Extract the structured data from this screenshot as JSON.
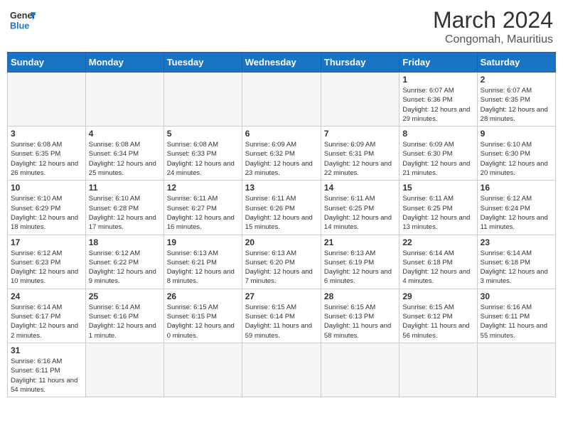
{
  "header": {
    "logo_general": "General",
    "logo_blue": "Blue",
    "month_title": "March 2024",
    "location": "Congomah, Mauritius"
  },
  "days_of_week": [
    "Sunday",
    "Monday",
    "Tuesday",
    "Wednesday",
    "Thursday",
    "Friday",
    "Saturday"
  ],
  "weeks": [
    [
      {
        "day": "",
        "info": ""
      },
      {
        "day": "",
        "info": ""
      },
      {
        "day": "",
        "info": ""
      },
      {
        "day": "",
        "info": ""
      },
      {
        "day": "",
        "info": ""
      },
      {
        "day": "1",
        "info": "Sunrise: 6:07 AM\nSunset: 6:36 PM\nDaylight: 12 hours\nand 29 minutes."
      },
      {
        "day": "2",
        "info": "Sunrise: 6:07 AM\nSunset: 6:35 PM\nDaylight: 12 hours\nand 28 minutes."
      }
    ],
    [
      {
        "day": "3",
        "info": "Sunrise: 6:08 AM\nSunset: 6:35 PM\nDaylight: 12 hours\nand 26 minutes."
      },
      {
        "day": "4",
        "info": "Sunrise: 6:08 AM\nSunset: 6:34 PM\nDaylight: 12 hours\nand 25 minutes."
      },
      {
        "day": "5",
        "info": "Sunrise: 6:08 AM\nSunset: 6:33 PM\nDaylight: 12 hours\nand 24 minutes."
      },
      {
        "day": "6",
        "info": "Sunrise: 6:09 AM\nSunset: 6:32 PM\nDaylight: 12 hours\nand 23 minutes."
      },
      {
        "day": "7",
        "info": "Sunrise: 6:09 AM\nSunset: 6:31 PM\nDaylight: 12 hours\nand 22 minutes."
      },
      {
        "day": "8",
        "info": "Sunrise: 6:09 AM\nSunset: 6:30 PM\nDaylight: 12 hours\nand 21 minutes."
      },
      {
        "day": "9",
        "info": "Sunrise: 6:10 AM\nSunset: 6:30 PM\nDaylight: 12 hours\nand 20 minutes."
      }
    ],
    [
      {
        "day": "10",
        "info": "Sunrise: 6:10 AM\nSunset: 6:29 PM\nDaylight: 12 hours\nand 18 minutes."
      },
      {
        "day": "11",
        "info": "Sunrise: 6:10 AM\nSunset: 6:28 PM\nDaylight: 12 hours\nand 17 minutes."
      },
      {
        "day": "12",
        "info": "Sunrise: 6:11 AM\nSunset: 6:27 PM\nDaylight: 12 hours\nand 16 minutes."
      },
      {
        "day": "13",
        "info": "Sunrise: 6:11 AM\nSunset: 6:26 PM\nDaylight: 12 hours\nand 15 minutes."
      },
      {
        "day": "14",
        "info": "Sunrise: 6:11 AM\nSunset: 6:25 PM\nDaylight: 12 hours\nand 14 minutes."
      },
      {
        "day": "15",
        "info": "Sunrise: 6:11 AM\nSunset: 6:25 PM\nDaylight: 12 hours\nand 13 minutes."
      },
      {
        "day": "16",
        "info": "Sunrise: 6:12 AM\nSunset: 6:24 PM\nDaylight: 12 hours\nand 11 minutes."
      }
    ],
    [
      {
        "day": "17",
        "info": "Sunrise: 6:12 AM\nSunset: 6:23 PM\nDaylight: 12 hours\nand 10 minutes."
      },
      {
        "day": "18",
        "info": "Sunrise: 6:12 AM\nSunset: 6:22 PM\nDaylight: 12 hours\nand 9 minutes."
      },
      {
        "day": "19",
        "info": "Sunrise: 6:13 AM\nSunset: 6:21 PM\nDaylight: 12 hours\nand 8 minutes."
      },
      {
        "day": "20",
        "info": "Sunrise: 6:13 AM\nSunset: 6:20 PM\nDaylight: 12 hours\nand 7 minutes."
      },
      {
        "day": "21",
        "info": "Sunrise: 6:13 AM\nSunset: 6:19 PM\nDaylight: 12 hours\nand 6 minutes."
      },
      {
        "day": "22",
        "info": "Sunrise: 6:14 AM\nSunset: 6:18 PM\nDaylight: 12 hours\nand 4 minutes."
      },
      {
        "day": "23",
        "info": "Sunrise: 6:14 AM\nSunset: 6:18 PM\nDaylight: 12 hours\nand 3 minutes."
      }
    ],
    [
      {
        "day": "24",
        "info": "Sunrise: 6:14 AM\nSunset: 6:17 PM\nDaylight: 12 hours\nand 2 minutes."
      },
      {
        "day": "25",
        "info": "Sunrise: 6:14 AM\nSunset: 6:16 PM\nDaylight: 12 hours\nand 1 minute."
      },
      {
        "day": "26",
        "info": "Sunrise: 6:15 AM\nSunset: 6:15 PM\nDaylight: 12 hours\nand 0 minutes."
      },
      {
        "day": "27",
        "info": "Sunrise: 6:15 AM\nSunset: 6:14 PM\nDaylight: 11 hours\nand 59 minutes."
      },
      {
        "day": "28",
        "info": "Sunrise: 6:15 AM\nSunset: 6:13 PM\nDaylight: 11 hours\nand 58 minutes."
      },
      {
        "day": "29",
        "info": "Sunrise: 6:15 AM\nSunset: 6:12 PM\nDaylight: 11 hours\nand 56 minutes."
      },
      {
        "day": "30",
        "info": "Sunrise: 6:16 AM\nSunset: 6:11 PM\nDaylight: 11 hours\nand 55 minutes."
      }
    ],
    [
      {
        "day": "31",
        "info": "Sunrise: 6:16 AM\nSunset: 6:11 PM\nDaylight: 11 hours\nand 54 minutes."
      },
      {
        "day": "",
        "info": ""
      },
      {
        "day": "",
        "info": ""
      },
      {
        "day": "",
        "info": ""
      },
      {
        "day": "",
        "info": ""
      },
      {
        "day": "",
        "info": ""
      },
      {
        "day": "",
        "info": ""
      }
    ]
  ]
}
